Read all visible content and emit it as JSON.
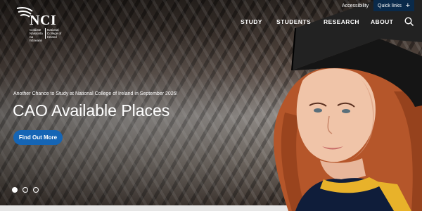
{
  "header": {
    "logo": {
      "wordmark": "NCI",
      "sub_left": "Coláiste Náisiúnta na hÉireann",
      "sub_right": "National College of Ireland"
    },
    "utility": {
      "accessibility": "Accessibility",
      "quick_links": "Quick links",
      "quick_links_icon": "plus-icon"
    },
    "nav": [
      {
        "label": "STUDY"
      },
      {
        "label": "STUDENTS"
      },
      {
        "label": "RESEARCH"
      },
      {
        "label": "ABOUT"
      }
    ],
    "search_icon": "search-icon"
  },
  "hero": {
    "kicker": "Another Chance to Study at National College of Ireland in September 2026!",
    "headline": "CAO Available Places",
    "cta": "Find Out More",
    "slides": {
      "count": 3,
      "active_index": 0
    }
  },
  "colors": {
    "cta": "#1565b5",
    "quick_links_bg": "#0a2a4a",
    "gown_trim": "#e8b22a"
  }
}
